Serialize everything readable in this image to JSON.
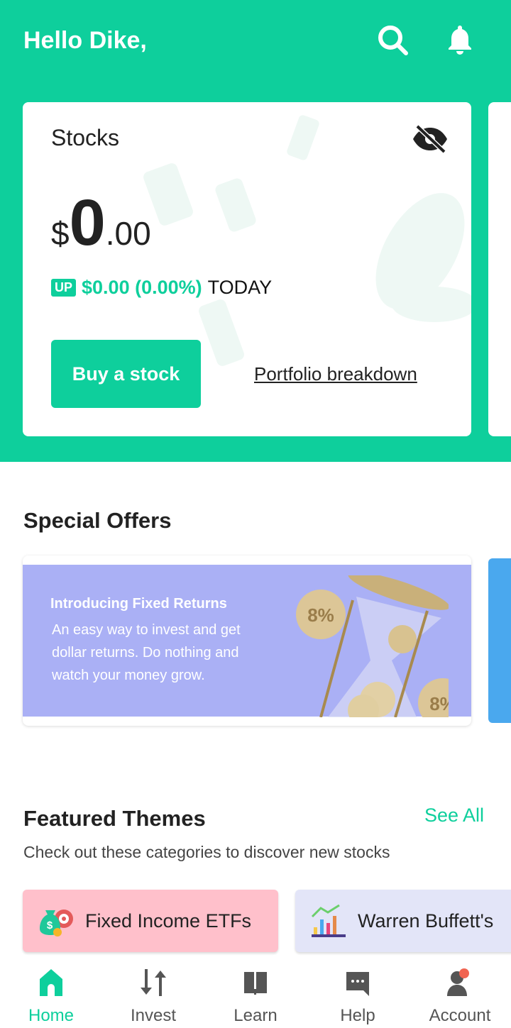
{
  "header": {
    "greeting": "Hello Dike,",
    "icons": [
      "search-icon",
      "bell-icon"
    ]
  },
  "portfolio": {
    "title": "Stocks",
    "currency": "$",
    "whole": "0",
    "decimal": ".00",
    "badge": "UP",
    "change": "$0.00 (0.00%)",
    "period": "TODAY",
    "buy_label": "Buy a stock",
    "breakdown_label": "Portfolio breakdown",
    "hide_icon": "eye-off-icon"
  },
  "offers": {
    "title": "Special Offers",
    "items": [
      {
        "title": "Introducing Fixed Returns",
        "text": "An easy way to invest and get dollar returns. Do nothing and watch your money grow.",
        "badge": "8%",
        "bg": "#aab0f5"
      }
    ]
  },
  "themes": {
    "title": "Featured Themes",
    "see_all": "See All",
    "subtitle": "Check out these categories to discover new stocks",
    "items": [
      {
        "label": "Fixed Income ETFs",
        "bg": "#ffc0cb"
      },
      {
        "label": "Warren Buffett's",
        "bg": "#e3e5f8"
      }
    ]
  },
  "nav": {
    "items": [
      {
        "label": "Home",
        "active": true
      },
      {
        "label": "Invest"
      },
      {
        "label": "Learn"
      },
      {
        "label": "Help"
      },
      {
        "label": "Account"
      }
    ]
  },
  "colors": {
    "accent": "#0ecf9c",
    "notification": "#f06451"
  }
}
